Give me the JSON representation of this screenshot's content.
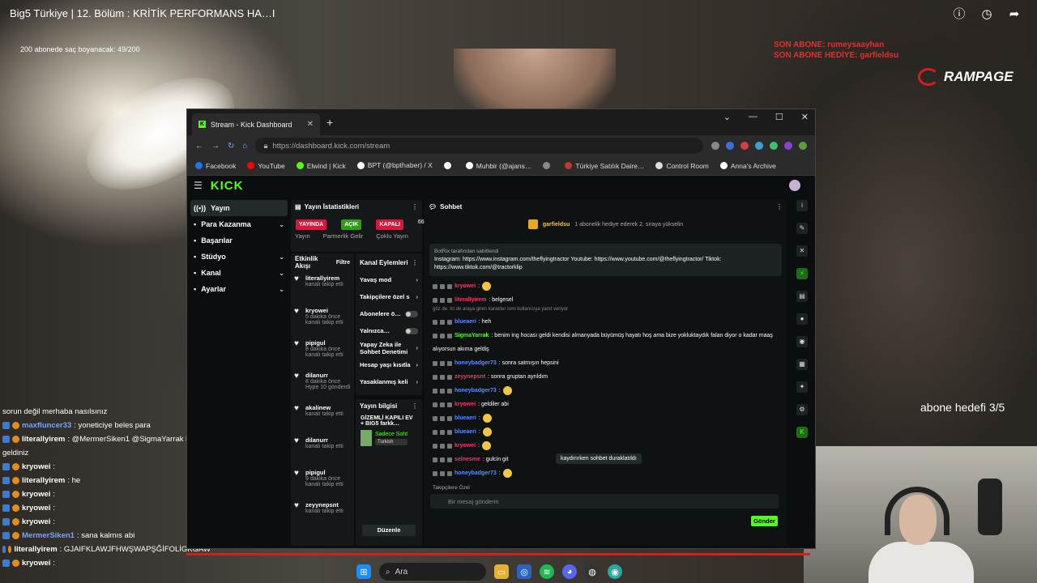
{
  "video": {
    "title": "Big5 Türkiye | 12. Bölüm : KRİTİK PERFORMANS HA…I",
    "sub_note": "200 abonede saç boyanacak: 49/200",
    "last_sub": "SON ABONE: rumeysaayhan",
    "last_gift": "SON ABONE HEDİYE: garfieldsu",
    "brand": "RAMPAGE",
    "goal": "abone hedefi 3/5",
    "icons": [
      "info-icon",
      "clock-icon",
      "share-icon"
    ]
  },
  "overlay_chat": [
    {
      "user": "",
      "text": "sorun değil merhaba nasılsınız"
    },
    {
      "user": "maxfluncer33",
      "text": ": yoneticiye beles para"
    },
    {
      "user": "literallyirem",
      "text": ": @MermerSiken1 @SigmaYarrak hoş"
    },
    {
      "user": "",
      "text": "geldiniz"
    },
    {
      "user": "kryowei",
      "text": ":"
    },
    {
      "user": "literallyirem",
      "text": ": he"
    },
    {
      "user": "kryowei",
      "text": ":"
    },
    {
      "user": "kryowei",
      "text": ":"
    },
    {
      "user": "kryowei",
      "text": ":"
    },
    {
      "user": "MermerSiken1",
      "text": ": sana kalmıs abi"
    },
    {
      "user": "literallyirem",
      "text": ": GJAIFKLAWJFHWŞWAPŞĞİFOLİGKGAW"
    },
    {
      "user": "kryowei",
      "text": ":"
    }
  ],
  "taskbar": {
    "search": "Ara"
  },
  "browser": {
    "tab_title": "Stream - Kick Dashboard",
    "url": "https://dashboard.kick.com/stream",
    "bookmarks": [
      "Facebook",
      "YouTube",
      "Elwind | Kick",
      "BPT (@bptհaber) / X",
      "",
      "Muhbir (@ajans…",
      "",
      "Türkiye Satılık Daire…",
      "Control Room",
      "Anna's Archive"
    ]
  },
  "kick": {
    "logo": "KICK",
    "nav": [
      {
        "label": "Yayın",
        "chev": ""
      },
      {
        "label": "Para Kazanma",
        "chev": "⌄"
      },
      {
        "label": "Başarılar",
        "chev": ""
      },
      {
        "label": "Stüdyo",
        "chev": "⌄"
      },
      {
        "label": "Kanal",
        "chev": "⌄"
      },
      {
        "label": "Ayarlar",
        "chev": "⌄"
      }
    ],
    "stats_title": "Yayın İstatistikleri",
    "stats": [
      {
        "pill": "YAYINDA",
        "label": "Yayın",
        "color": "#d8173a"
      },
      {
        "pill": "AÇIK",
        "label": "Partnerlik Gelir",
        "color": "#2ea010"
      },
      {
        "pill": "KAPALI",
        "label": "Çoklu Yayın",
        "color": "#d8173a"
      }
    ],
    "stats_extra": "66",
    "activity_title": "Etkinlik Akışı",
    "filter": "Filtre",
    "activity": [
      {
        "name": "literallyirem",
        "time": "",
        "action": "kanalı takip etti"
      },
      {
        "name": "kryowei",
        "time": "5 dakika önce",
        "action": "kanalı takip etti"
      },
      {
        "name": "pipigul",
        "time": "8 dakika önce",
        "action": "kanalı takip etti"
      },
      {
        "name": "dilanurr",
        "time": "8 dakika önce",
        "action": "Hype 10 gönderdi"
      },
      {
        "name": "akalinew",
        "time": "",
        "action": "kanalı takip etti"
      },
      {
        "name": "dilanurr",
        "time": "",
        "action": "kanalı takip etti"
      },
      {
        "name": "pipigul",
        "time": "9 dakika önce",
        "action": "kanalı takip etti"
      },
      {
        "name": "zeyynepsnt",
        "time": "",
        "action": "kanalı takip etti"
      }
    ],
    "channel_title": "Kanal Eylemleri",
    "channel": [
      {
        "label": "Yavaş mod",
        "type": "arr"
      },
      {
        "label": "Takipçilere özel s",
        "type": "arr"
      },
      {
        "label": "Abonelere ö…",
        "type": "toggle"
      },
      {
        "label": "Yalnızca…",
        "type": "toggle"
      },
      {
        "label": "Yapay Zeka ile Sohbet Denetimi",
        "type": "arr"
      },
      {
        "label": "Hesap yaşı kısıtla",
        "type": "arr"
      },
      {
        "label": "Yasaklanmış keli",
        "type": "arr"
      }
    ],
    "info_title": "Yayın bilgisi",
    "info_text": "GİZEMLİ KAPILI EV + BIG5 farkk…",
    "info_sub": "Sadece Soht",
    "info_tag": "Turkish",
    "edit": "Düzenle",
    "chat_title": "Sohbet",
    "gift_user": "garfieldsu",
    "gift_text": "1 abonelik hediye ederek 2. sıraya yükselin",
    "pinned_by": "BotRix tarafından sabitlendi",
    "pinned_text": "Instagram: https://www.instagram.com/theflyingtractor Youtube: https://www.youtube.com/@theflyingtractor/ Tiktok: https://www.tiktok.com/@tractorklip",
    "reply_note": "göz de: lcl de araya giren karakter ismi kullanıcıya yanıt veriyor",
    "messages": [
      {
        "user": "kryowei",
        "text": ":",
        "cls": "",
        "emo": true
      },
      {
        "user": "literallyirem",
        "text": ": belgesel",
        "cls": "",
        "emo": false
      },
      {
        "user": "blueaeri",
        "text": ": heh",
        "cls": "b",
        "emo": false
      },
      {
        "user": "SigmaYarrak",
        "text": ": benim ing hocası geldi kendisi almanyada büyümüş hayatı hoş ama bize yokluktaydık falan diyor o kadar maaş",
        "cls": "g",
        "emo": false
      },
      {
        "user": "honeybadger73",
        "text": ": sonra satmışın hepsini",
        "cls": "b",
        "emo": false
      },
      {
        "user": "zeyynepsnt",
        "text": ": sonra gruptan ayrıldım",
        "cls": "",
        "emo": false
      },
      {
        "user": "honeybadger73",
        "text": ":",
        "cls": "b",
        "emo": true
      },
      {
        "user": "kryowei",
        "text": ": geldiler abi",
        "cls": "",
        "emo": false
      },
      {
        "user": "blueaeri",
        "text": ":",
        "cls": "b",
        "emo": true
      },
      {
        "user": "blueaeri",
        "text": ":",
        "cls": "b",
        "emo": true
      },
      {
        "user": "kryowei",
        "text": ":",
        "cls": "",
        "emo": true
      },
      {
        "user": "selnesme",
        "text": ": gulcin git",
        "cls": "",
        "emo": false
      },
      {
        "user": "honeybadger73",
        "text": ":",
        "cls": "b",
        "emo": true
      }
    ],
    "extra_line": "alıyorsun akıma geldiş",
    "paused": "kaydırırken sohbet duraklatıldı",
    "follower_only": "Takipçilere Özel",
    "input_placeholder": "Bir mesaj gönderin",
    "send": "Gönder"
  }
}
